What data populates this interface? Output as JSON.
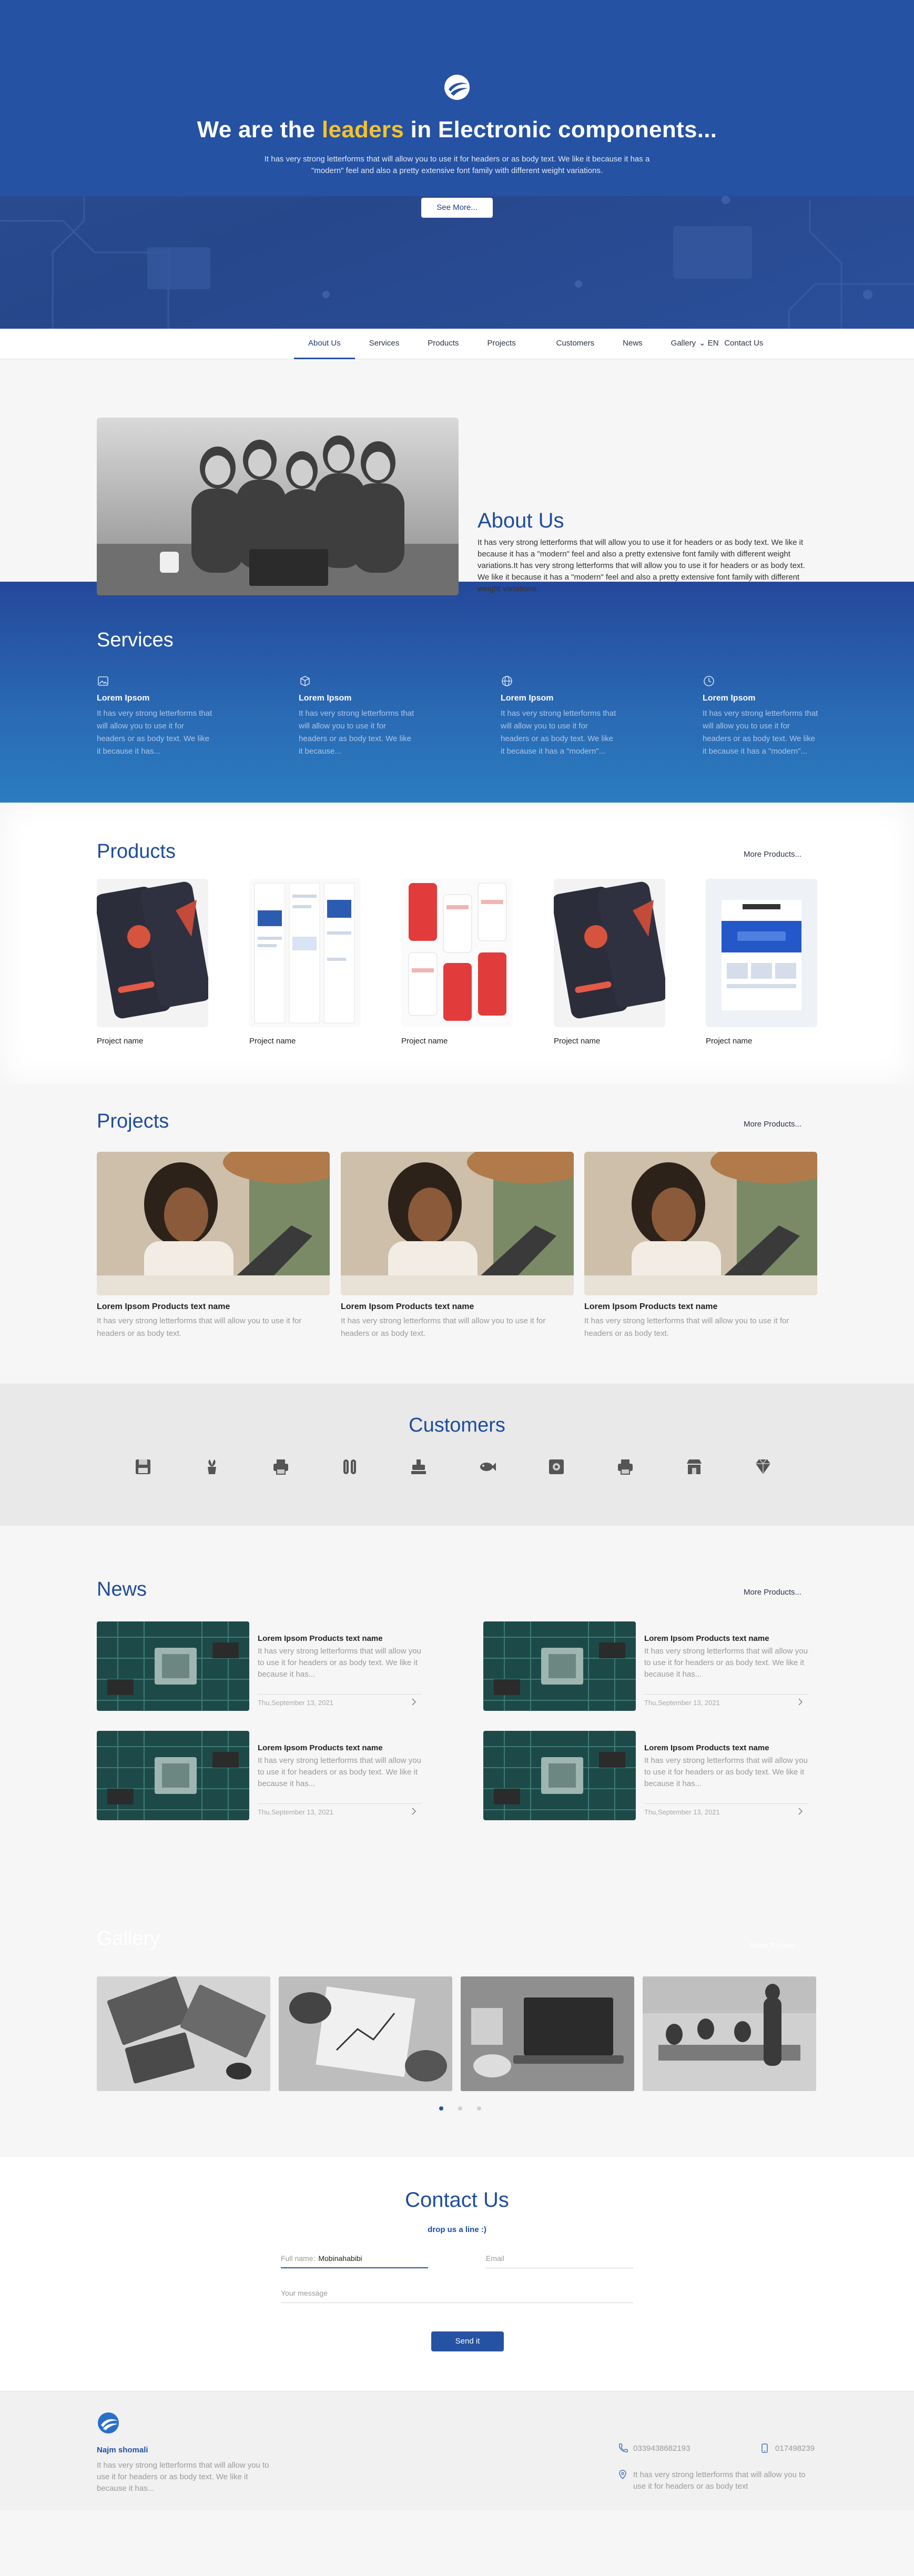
{
  "hero": {
    "title_pre": "We are the ",
    "title_highlight": "leaders",
    "title_post": " in Electronic components...",
    "text": "It has very strong letterforms that will allow you to use it for headers or as body text. We like it because it has a \"modern\" feel and also a pretty extensive font family with different weight variations.",
    "button": "See More..."
  },
  "nav": {
    "items": [
      "About Us",
      "Services",
      "Products",
      "Projects",
      "Customers",
      "News",
      "Gallery",
      "Contact Us"
    ],
    "active": "About Us",
    "lang": "EN"
  },
  "about": {
    "title": "About Us",
    "text": "It has very strong letterforms that will allow you to use it for headers or as body text. We like it because it has a \"modern\" feel and also a pretty extensive font family with different weight variations.It has very strong letterforms that will allow you to use it for headers or as body text. We like it because it has a \"modern\" feel and also a pretty extensive font family with different weight variations."
  },
  "services": {
    "title": "Services",
    "items": [
      {
        "icon": "image-icon",
        "title": "Lorem Ipsom",
        "text": "It has very strong letterforms that will allow you to use it for headers or as body text. We like it because it has..."
      },
      {
        "icon": "box-icon",
        "title": "Lorem Ipsom",
        "text": "It has very strong letterforms that will allow you to use it for headers or as body text. We like it because..."
      },
      {
        "icon": "globe-icon",
        "title": "Lorem Ipsom",
        "text": "It has very strong letterforms that will allow you to use it for headers or as body text. We like it because it has a \"modern\"..."
      },
      {
        "icon": "clock-icon",
        "title": "Lorem Ipsom",
        "text": "It has very strong letterforms that will allow you to use it for headers or as body text. We like it because it has a \"modern\"..."
      }
    ]
  },
  "products": {
    "title": "Products",
    "more": "More Products...",
    "items": [
      {
        "name": "Project name"
      },
      {
        "name": "Project name"
      },
      {
        "name": "Project name"
      },
      {
        "name": "Project name"
      },
      {
        "name": "Project name"
      }
    ]
  },
  "projects": {
    "title": "Projects",
    "more": "More Products...",
    "items": [
      {
        "title": "Lorem Ipsom Products text name",
        "text": "It has very strong letterforms that will allow you to use it for headers or as body text."
      },
      {
        "title": "Lorem Ipsom Products text name",
        "text": "It has very strong letterforms that will allow you to use it for headers or as body text."
      },
      {
        "title": "Lorem Ipsom Products text name",
        "text": "It has very strong letterforms that will allow you to use it for headers or as body text."
      }
    ]
  },
  "customers": {
    "title": "Customers",
    "icons": [
      "floppy-icon",
      "plant-icon",
      "printer-icon",
      "beans-icon",
      "stamp-icon",
      "fish-icon",
      "safe-icon",
      "printer-icon",
      "shop-icon",
      "diamond-icon"
    ]
  },
  "news": {
    "title": "News",
    "more": "More Products...",
    "items": [
      {
        "title": "Lorem Ipsom Products text name",
        "text": "It has very strong letterforms that will allow you to use it for headers or as body text. We like it because it has...",
        "date": "Thu,September 13, 2021"
      },
      {
        "title": "Lorem Ipsom Products text name",
        "text": "It has very strong letterforms that will allow you to use it for headers or as body text. We like it because it has...",
        "date": "Thu,September 13, 2021"
      },
      {
        "title": "Lorem Ipsom Products text name",
        "text": "It has very strong letterforms that will allow you to use it for headers or as body text. We like it because it has...",
        "date": "Thu,September 13, 2021"
      },
      {
        "title": "Lorem Ipsom Products text name",
        "text": "It has very strong letterforms that will allow you to use it for headers or as body text. We like it because it has...",
        "date": "Thu,September 13, 2021"
      }
    ]
  },
  "gallery": {
    "title": "Gallery",
    "more": "More Picture..."
  },
  "contact": {
    "title": "Contact Us",
    "subtitle": "drop us a line :)",
    "fullname_label": "Full name:",
    "fullname_value": "Mobinahabibi",
    "email_placeholder": "Email",
    "message_placeholder": "Your message",
    "send": "Send it"
  },
  "footer": {
    "brand": "Najm shomali",
    "text": "It has very strong letterforms that will allow you to use it for headers or as body text. We like it because it has...",
    "phone1": "0339438682193",
    "phone2": "017498239",
    "address": "It has very strong letterforms that will allow you to use it for headers or as body text"
  },
  "colors": {
    "primary": "#2552a3",
    "accent": "#f4c22c",
    "heading": "#1f4c9e"
  }
}
